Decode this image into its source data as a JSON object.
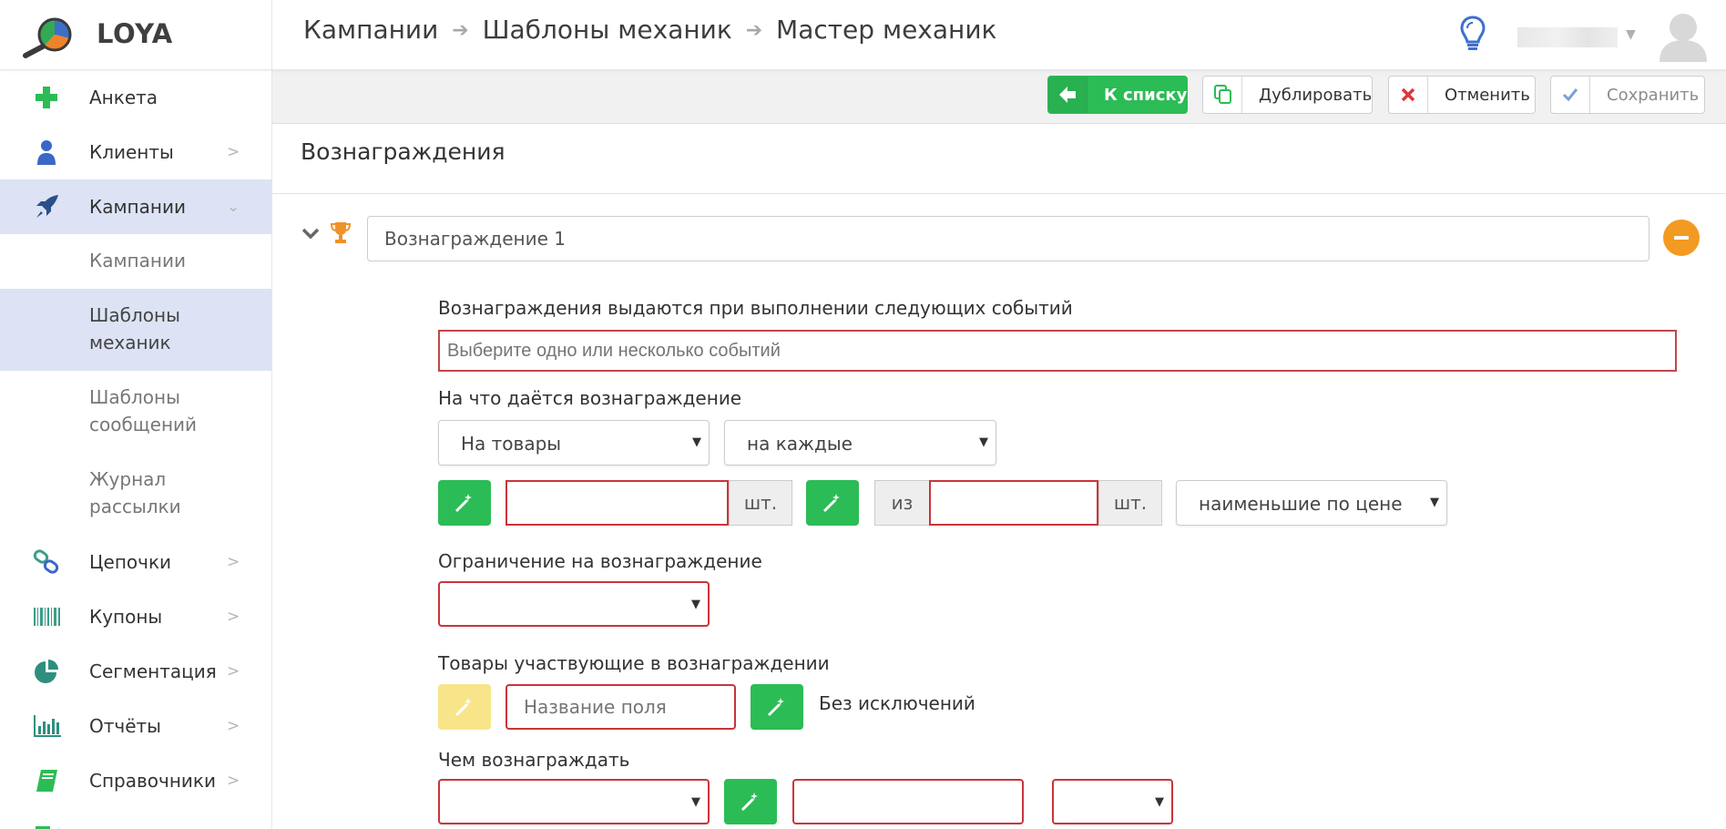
{
  "app": {
    "logo_text": "LOYA"
  },
  "breadcrumb": [
    "Кампании",
    "Шаблоны механик",
    "Мастер механик"
  ],
  "colors": {
    "accent_green": "#2cbc55",
    "active_nav_bg": "#dde3f4",
    "error_border": "#c9353b",
    "orange": "#f29a21",
    "wand_yellow": "#f8e58a"
  },
  "sidebar": {
    "items": [
      {
        "label": "Анкета",
        "icon": "plus-icon"
      },
      {
        "label": "Клиенты",
        "icon": "user-icon"
      },
      {
        "label": "Кампании",
        "icon": "rocket-icon"
      },
      {
        "label": "Цепочки",
        "icon": "chain-link-icon"
      },
      {
        "label": "Купоны",
        "icon": "barcode-icon"
      },
      {
        "label": "Сегментация",
        "icon": "pie-chart-icon"
      },
      {
        "label": "Отчёты",
        "icon": "bar-chart-icon"
      },
      {
        "label": "Справочники",
        "icon": "book-icon"
      }
    ],
    "sub_items": [
      {
        "label": "Кампании"
      },
      {
        "label_line1": "Шаблоны",
        "label_line2": "механик"
      },
      {
        "label_line1": "Шаблоны",
        "label_line2": "сообщений"
      },
      {
        "label_line1": "Журнал",
        "label_line2": "рассылки"
      }
    ]
  },
  "toolbar": {
    "back_label": "К списку",
    "duplicate_label": "Дублировать",
    "cancel_label": "Отменить",
    "save_label": "Сохранить"
  },
  "main": {
    "section_title": "Вознаграждения",
    "reward": {
      "name": "Вознаграждение 1",
      "events_label": "Вознаграждения выдаются при выполнении следующих событий",
      "events_placeholder": "Выберите одно или несколько событий",
      "target_label": "На что даётся вознаграждение",
      "target_select": "На товары",
      "frequency_select": "на каждые",
      "qty_unit": "шт.",
      "of_label": "из",
      "qty_unit2": "шт.",
      "order_select": "наименьшие по цене",
      "limit_label": "Ограничение на вознаграждение",
      "limit_select": "",
      "products_label": "Товары участвующие в вознаграждении",
      "field_placeholder": "Название поля",
      "no_exclusions": "Без исключений",
      "reward_with_label": "Чем вознаграждать"
    }
  }
}
